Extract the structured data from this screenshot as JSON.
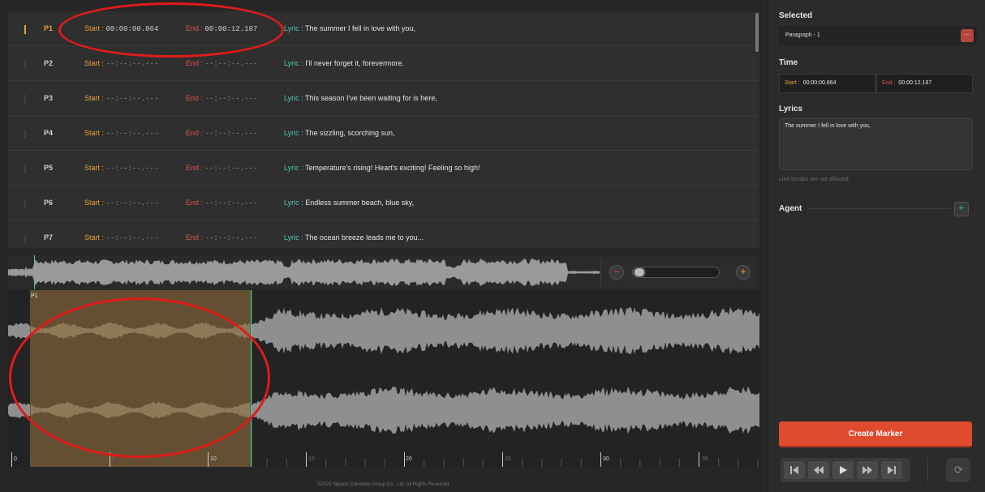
{
  "paragraphs": [
    {
      "id": "P1",
      "start_label": "Start :",
      "start": "00:00:00.864",
      "end_label": "End :",
      "end": "00:00:12.187",
      "lyric_label": "Lyric :",
      "lyric": "The summer I fell in love with you,",
      "active": true
    },
    {
      "id": "P2",
      "start_label": "Start :",
      "start": "--:--:--.---",
      "end_label": "End :",
      "end": "--:--:--.---",
      "lyric_label": "Lyric :",
      "lyric": "I'll never forget it, forevermore."
    },
    {
      "id": "P3",
      "start_label": "Start :",
      "start": "--:--:--.---",
      "end_label": "End :",
      "end": "--:--:--.---",
      "lyric_label": "Lyric :",
      "lyric": "This season I've been waiting for is here,"
    },
    {
      "id": "P4",
      "start_label": "Start :",
      "start": "--:--:--.---",
      "end_label": "End :",
      "end": "--:--:--.---",
      "lyric_label": "Lyric :",
      "lyric": "The sizzling, scorching sun,"
    },
    {
      "id": "P5",
      "start_label": "Start :",
      "start": "--:--:--.---",
      "end_label": "End :",
      "end": "--:--:--.---",
      "lyric_label": "Lyric :",
      "lyric": "Temperature's rising! Heart's exciting! Feeling so high!"
    },
    {
      "id": "P6",
      "start_label": "Start :",
      "start": "--:--:--.---",
      "end_label": "End :",
      "end": "--:--:--.---",
      "lyric_label": "Lyric :",
      "lyric": "Endless summer beach, blue sky,"
    },
    {
      "id": "P7",
      "start_label": "Start :",
      "start": "--:--:--.---",
      "end_label": "End :",
      "end": "--:--:--.---",
      "lyric_label": "Lyric :",
      "lyric": "The ocean breeze leads me to you..."
    }
  ],
  "waveform": {
    "region_label": "P1",
    "zoom_minus": "−",
    "zoom_plus": "+",
    "zoom_level": 0.0,
    "timeline_ticks": [
      {
        "t": "0",
        "strong": true
      },
      {
        "t": "5",
        "strong": false
      },
      {
        "t": "10",
        "strong": true
      },
      {
        "t": "15",
        "strong": false
      },
      {
        "t": "20",
        "strong": true
      },
      {
        "t": "25",
        "strong": false
      },
      {
        "t": "30",
        "strong": true
      },
      {
        "t": "35",
        "strong": false
      }
    ],
    "region_color": "#6b5434",
    "accent_color": "#e8a23a"
  },
  "footer": "©2025 Nippon Columbia Group Co., Ltd. All Rights Reserved.",
  "panel": {
    "selected_label": "Selected",
    "selected_value": "Paragraph - 1",
    "selected_clear": "−",
    "time_label": "Time",
    "start_label": "Start :",
    "start_value": "00:00:00.864",
    "end_label": "End :",
    "end_value": "00:00:12.187",
    "lyrics_label": "Lyrics",
    "lyrics_value": "The summer I fell in love with you,",
    "lyrics_note": "Line breaks are not allowed.",
    "agent_label": "Agent",
    "agent_add": "+",
    "create_marker": "Create Marker",
    "transport": [
      "skip-start-icon",
      "rewind-icon",
      "play-icon",
      "fast-forward-icon",
      "skip-end-icon"
    ],
    "loop_icon": "⟳",
    "create_color": "#e04a2d"
  }
}
